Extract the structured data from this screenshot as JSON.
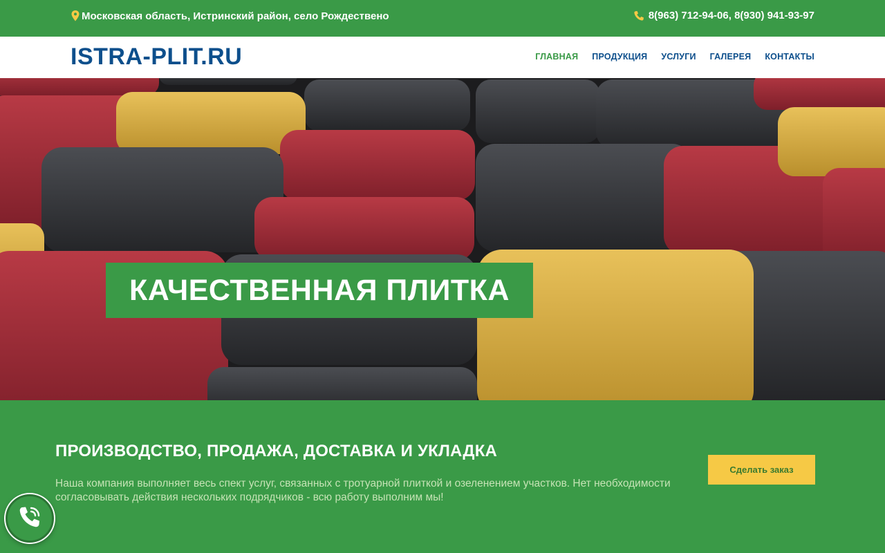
{
  "topbar": {
    "address": "Московская область, Истринский район, село Рождествено",
    "phones": "8(963) 712-94-06, 8(930) 941-93-97",
    "icons": [
      "map-pin-icon",
      "phone-icon"
    ],
    "accent_color": "#f6c945"
  },
  "header": {
    "logo": "ISTRA-PLIT.RU",
    "nav": [
      {
        "label": "ГЛАВНАЯ",
        "active": true
      },
      {
        "label": "ПРОДУКЦИЯ",
        "active": false
      },
      {
        "label": "УСЛУГИ",
        "active": false
      },
      {
        "label": "ГАЛЕРЕЯ",
        "active": false
      },
      {
        "label": "КОНТАКТЫ",
        "active": false
      }
    ]
  },
  "hero": {
    "banner_text": "КАЧЕСТВЕННАЯ ПЛИТКА"
  },
  "service": {
    "title": "ПРОИЗВОДСТВО, ПРОДАЖА, ДОСТАВКА И УКЛАДКА",
    "text": "Наша компания выполняет весь спект услуг, связанных с тротуарной плиткой и озеленением участков. Нет необходимости согласовывать действия нескольких подрядчиков - всю работу выполним мы!",
    "button_label": "Сделать заказ"
  },
  "call_widget": {
    "icon": "phone-call-icon"
  },
  "colors": {
    "brand_green": "#3a9a47",
    "brand_blue": "#0d4f8c",
    "button_yellow": "#f6c945"
  }
}
